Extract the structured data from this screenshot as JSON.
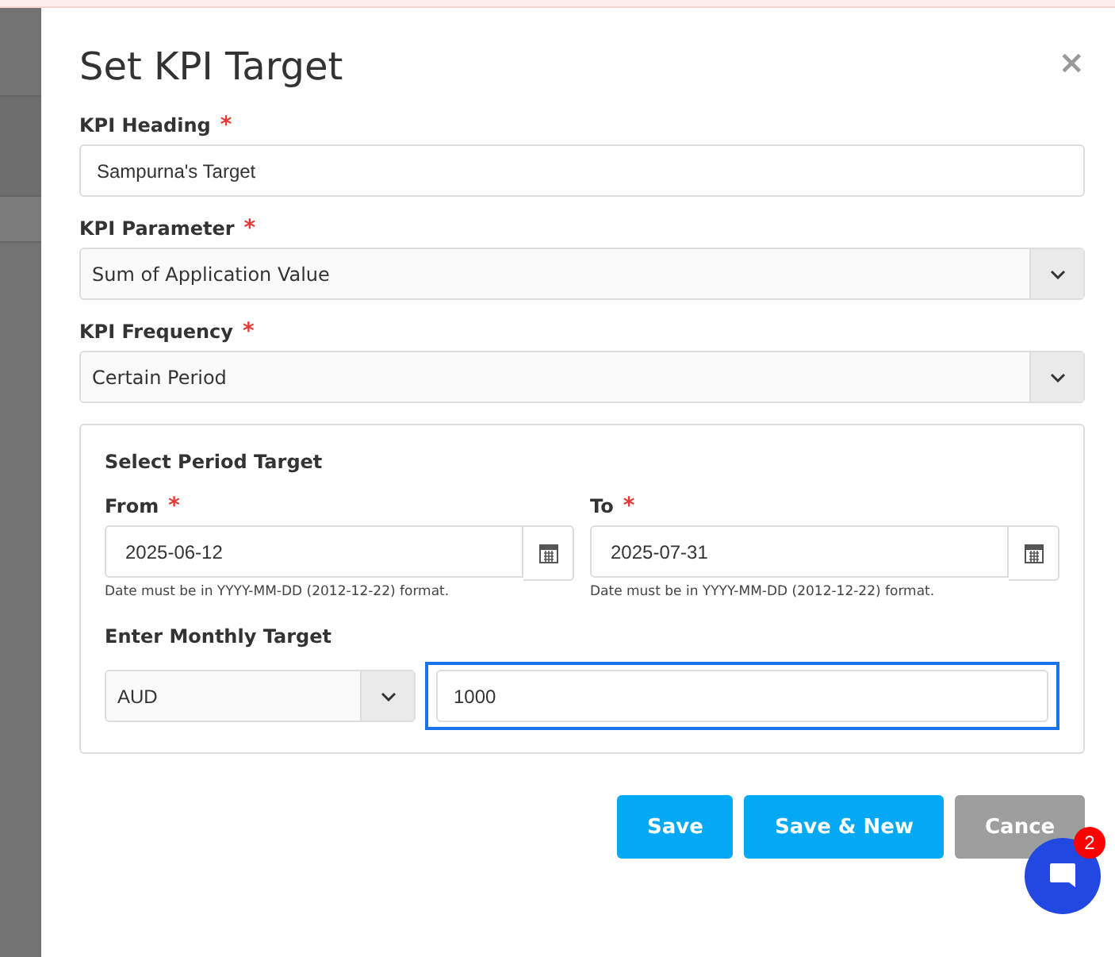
{
  "dialog": {
    "title": "Set KPI Target",
    "close": "×"
  },
  "fields": [
    {
      "kind": "text",
      "label": "KPI Heading",
      "mark": "*",
      "value": "Sampurna's Target"
    },
    {
      "kind": "select",
      "label": "KPI Parameter",
      "mark": "*",
      "value": "Sum of Application Value"
    },
    {
      "kind": "select",
      "label": "KPI Frequency",
      "mark": "*",
      "value": "Certain Period"
    }
  ],
  "period": {
    "title": "Select Period Target",
    "dates": [
      {
        "label": "From",
        "mark": "*",
        "value": "2025-06-12",
        "hint": "Date must be in YYYY-MM-DD (2012-12-22) format."
      },
      {
        "label": "To",
        "mark": "*",
        "value": "2025-07-31",
        "hint": "Date must be in YYYY-MM-DD (2012-12-22) format."
      }
    ],
    "target_label": "Enter Monthly Target",
    "currency": "AUD",
    "amount": "1000",
    "amount_focused": true
  },
  "buttons": [
    {
      "label": "Save",
      "kind": "primary"
    },
    {
      "label": "Save & New",
      "kind": "primary"
    },
    {
      "label": "Cance",
      "kind": "secondary"
    }
  ],
  "chat": {
    "badge": "2"
  }
}
